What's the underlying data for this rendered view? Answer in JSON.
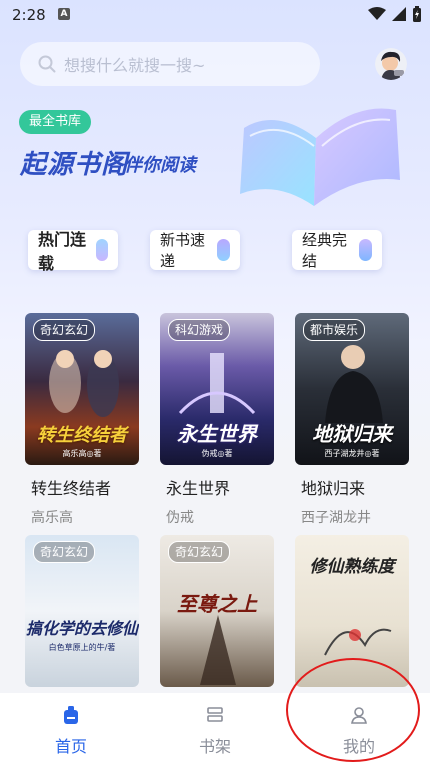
{
  "status": {
    "time": "2:28",
    "app_letter": "A"
  },
  "search": {
    "placeholder": "想搜什么就搜一搜~"
  },
  "hero": {
    "badge": "最全书库",
    "title": "起源书阁",
    "subtitle": "伴你阅读"
  },
  "chips": [
    {
      "label": "热门连载"
    },
    {
      "label": "新书速递"
    },
    {
      "label": "经典完结"
    }
  ],
  "books": [
    {
      "genre": "奇幻玄幻",
      "cover_title": "转生终结者",
      "cover_author": "高乐高◎著",
      "title": "转生终结者",
      "author": "高乐高"
    },
    {
      "genre": "科幻游戏",
      "cover_title": "永生世界",
      "cover_author": "伪戒◎著",
      "title": "永生世界",
      "author": "伪戒"
    },
    {
      "genre": "都市娱乐",
      "cover_title": "地狱归来",
      "cover_author": "西子湖龙井◎著",
      "title": "地狱归来",
      "author": "西子湖龙井"
    },
    {
      "genre": "奇幻玄幻",
      "cover_title": "搞化学的去修仙",
      "cover_author": "白色草原上的牛/著"
    },
    {
      "genre": "奇幻玄幻",
      "cover_title": "至尊之上"
    },
    {
      "genre": "",
      "cover_title": "修仙熟练度"
    }
  ],
  "tabs": [
    {
      "label": "首页",
      "active": true
    },
    {
      "label": "书架",
      "active": false
    },
    {
      "label": "我的",
      "active": false
    }
  ],
  "colors": {
    "accent": "#2a66e8",
    "badge": "#33c79a",
    "hero_text": "#2f4fc2",
    "annotation": "#e21b1b"
  }
}
